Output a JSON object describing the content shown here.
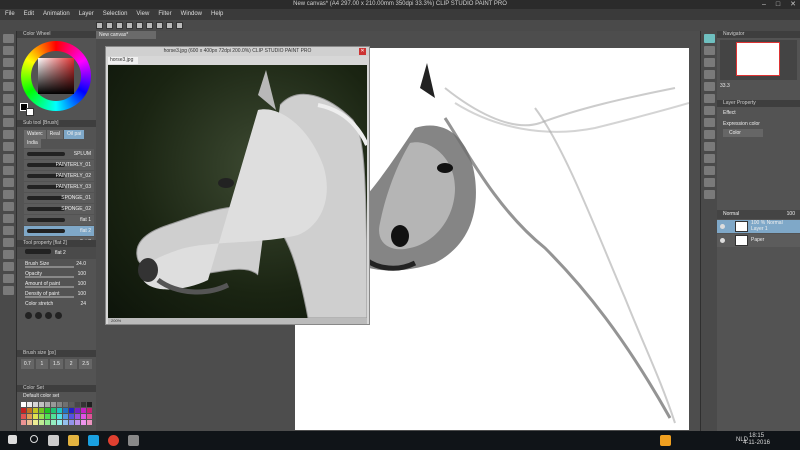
{
  "window": {
    "title": "New canvas* (A4 297.00 x 210.00mm 350dpi 33.3%)  CLIP STUDIO PAINT PRO"
  },
  "menu": [
    "File",
    "Edit",
    "Animation",
    "Layer",
    "Selection",
    "View",
    "Filter",
    "Window",
    "Help"
  ],
  "left_panel": {
    "color_wheel_title": "Color Wheel",
    "subtool_title": "Sub tool [Brush]",
    "subtool_tabs": [
      "Waterc",
      "Real",
      "Oil pai",
      "India"
    ],
    "brushes": [
      "SPLUM",
      "PAINTERLY_01",
      "PAINTERLY_02",
      "PAINTERLY_03",
      "SPONGE_01",
      "SPONGE_02",
      "flat 1",
      "flat 2",
      "flat 3"
    ],
    "selected_brush_index": 7,
    "tool_property_title": "Tool property [flat 2]",
    "tool_property_brush": "flat 2",
    "properties": [
      {
        "label": "Brush Size",
        "value": "24.0"
      },
      {
        "label": "Opacity",
        "value": "100"
      },
      {
        "label": "Amount of paint",
        "value": "100"
      },
      {
        "label": "Density of paint",
        "value": "100"
      },
      {
        "label": "Color stretch",
        "value": "24"
      }
    ],
    "brush_size_title": "Brush size [px]",
    "sizes": [
      "0.7",
      "1",
      "1.5",
      "2",
      "2.5"
    ],
    "color_set_title": "Color Set",
    "color_set_name": "Default color set"
  },
  "canvas": {
    "tab": "New canvas*",
    "reference_title": "horse3.jpg (600 x 400px 72dpi 200.0%)  CLIP STUDIO PAINT PRO",
    "reference_tab": "horse3.jpg",
    "reference_zoom": "200%"
  },
  "right_panel": {
    "navigator_title": "Navigator",
    "navigator_zoom": "33.3",
    "layer_property_title": "Layer Property",
    "effect_label": "Effect",
    "expression_color_label": "Expression color",
    "expression_color_value": "Color",
    "blend_mode": "Normal",
    "opacity": "100",
    "layers": [
      {
        "name": "Layer 1",
        "meta": "100 %  Normal",
        "selected": true
      },
      {
        "name": "Paper",
        "meta": "",
        "selected": false
      }
    ]
  },
  "taskbar": {
    "language": "NLD",
    "time": "18:15",
    "date": "4-11-2016"
  },
  "colors": {
    "accent": "#7fa8c8",
    "panel": "#535353",
    "dark": "#3c3c3c"
  }
}
